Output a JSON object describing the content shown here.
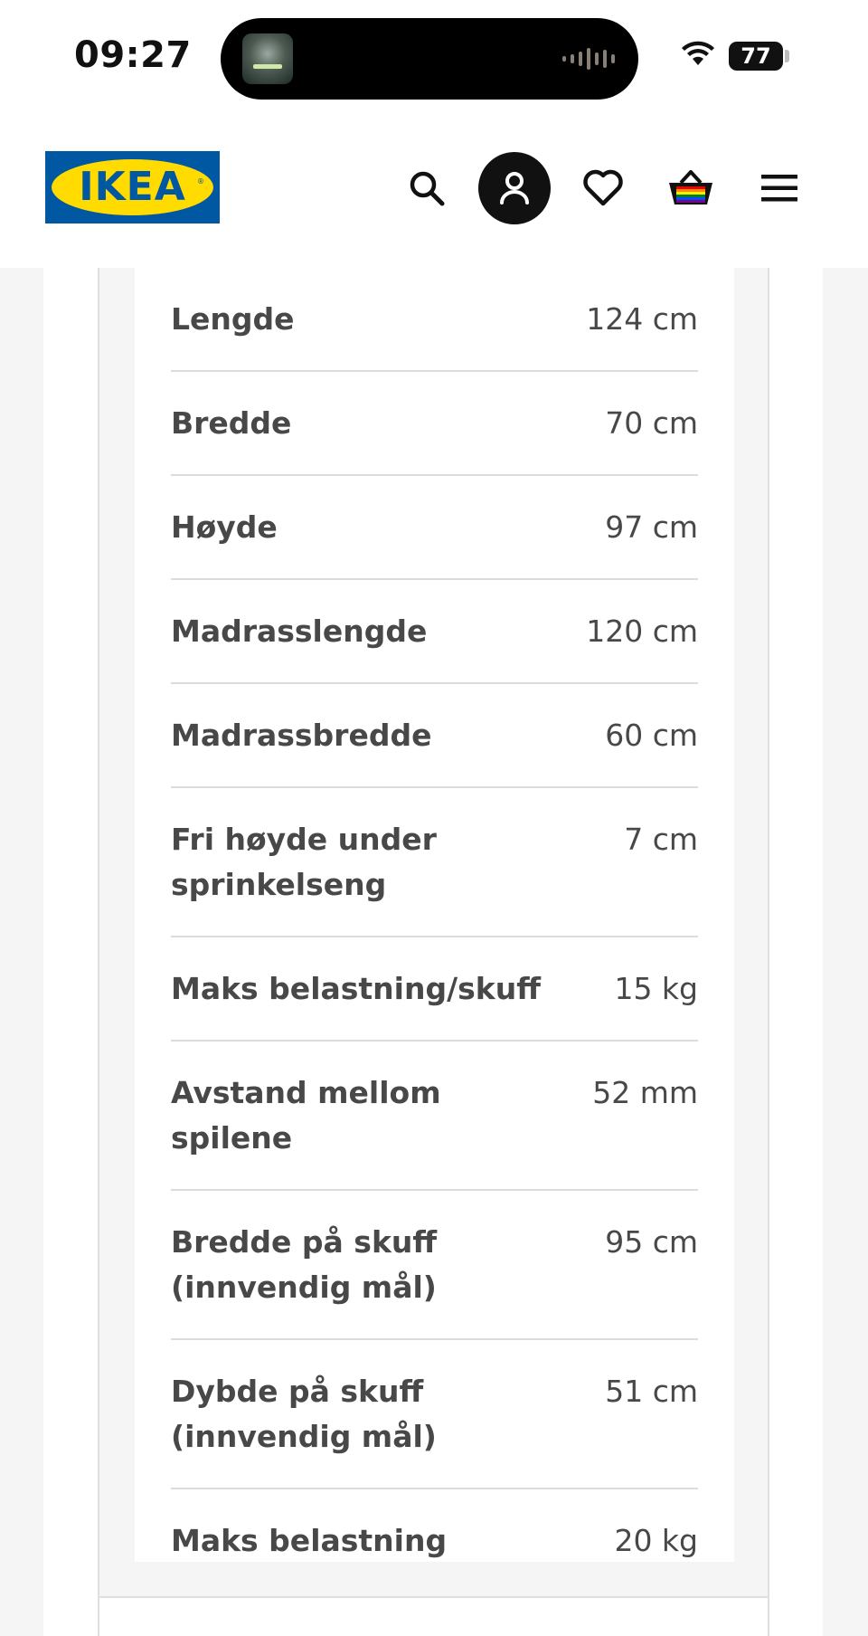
{
  "status_bar": {
    "time": "09:27",
    "battery": "77",
    "icons": [
      "now-playing-artwork",
      "waveform-icon",
      "wifi-icon",
      "battery-icon"
    ]
  },
  "header": {
    "logo_text": "IKEA",
    "brand_colors": {
      "blue": "#0058a3",
      "yellow": "#ffdb00"
    },
    "icons": [
      "search-icon",
      "profile-icon",
      "heart-icon",
      "basket-icon",
      "hamburger-menu-icon"
    ]
  },
  "specs": [
    {
      "label": "Lengde",
      "value": "124 cm"
    },
    {
      "label": "Bredde",
      "value": "70 cm"
    },
    {
      "label": "Høyde",
      "value": "97 cm"
    },
    {
      "label": "Madrasslengde",
      "value": "120 cm"
    },
    {
      "label": "Madrassbredde",
      "value": "60 cm"
    },
    {
      "label": "Fri høyde under sprinkelseng",
      "value": "7 cm"
    },
    {
      "label": "Maks belastning/skuff",
      "value": "15 kg"
    },
    {
      "label": "Avstand mellom spilene",
      "value": "52 mm"
    },
    {
      "label": "Bredde på skuff (innvendig mål)",
      "value": "95 cm"
    },
    {
      "label": "Dybde på skuff (innvendig mål)",
      "value": "51 cm"
    },
    {
      "label": "Maks belastning",
      "value": "20 kg"
    }
  ]
}
